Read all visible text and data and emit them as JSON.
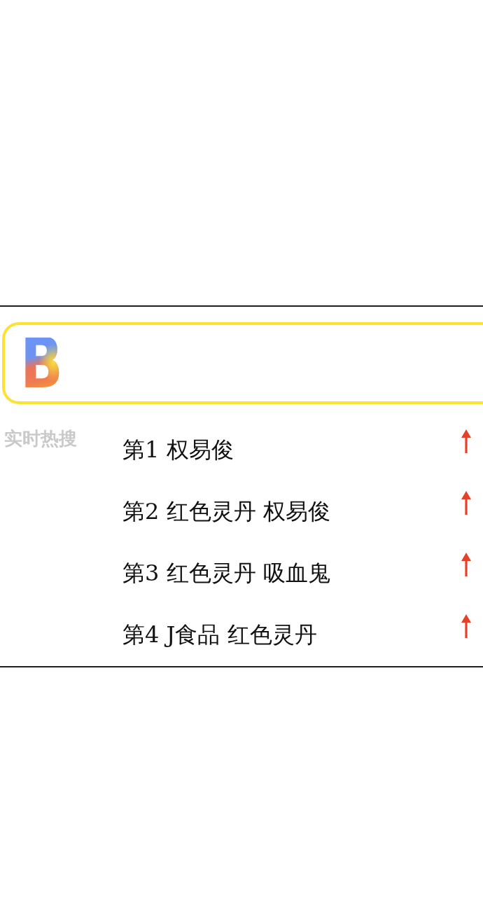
{
  "search_box": {
    "logo": "B"
  },
  "hot_search": {
    "title": "实时热搜",
    "items": [
      {
        "text": "第1 权易俊",
        "rising": true
      },
      {
        "text": "第2 红色灵丹 权易俊",
        "rising": true
      },
      {
        "text": "第3 红色灵丹 吸血鬼",
        "rising": true
      },
      {
        "text": "第4 J食品 红色灵丹",
        "rising": true
      }
    ]
  }
}
